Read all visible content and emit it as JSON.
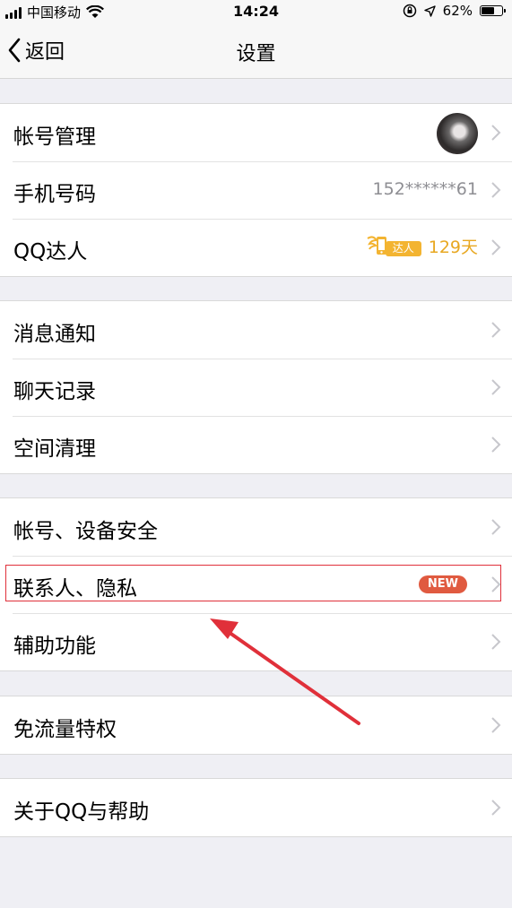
{
  "status_bar": {
    "carrier": "中国移动",
    "time": "14:24",
    "battery": "62%",
    "battery_level": 0.62
  },
  "nav": {
    "back_label": "返回",
    "title": "设置"
  },
  "groups": [
    {
      "items": [
        {
          "label": "帐号管理"
        },
        {
          "label": "手机号码",
          "value": "152******61"
        },
        {
          "label": "QQ达人",
          "badge": "达人",
          "value": "129天"
        }
      ]
    },
    {
      "items": [
        {
          "label": "消息通知"
        },
        {
          "label": "聊天记录"
        },
        {
          "label": "空间清理"
        }
      ]
    },
    {
      "items": [
        {
          "label": "帐号、设备安全"
        },
        {
          "label": "联系人、隐私",
          "badge": "NEW"
        },
        {
          "label": "辅助功能"
        }
      ]
    },
    {
      "items": [
        {
          "label": "免流量特权"
        }
      ]
    },
    {
      "items": [
        {
          "label": "关于QQ与帮助"
        }
      ]
    }
  ],
  "colors": {
    "background": "#efeff4",
    "accent_gold": "#e8a822",
    "new_badge": "#e05a40",
    "annotation_red": "#e0303a"
  }
}
